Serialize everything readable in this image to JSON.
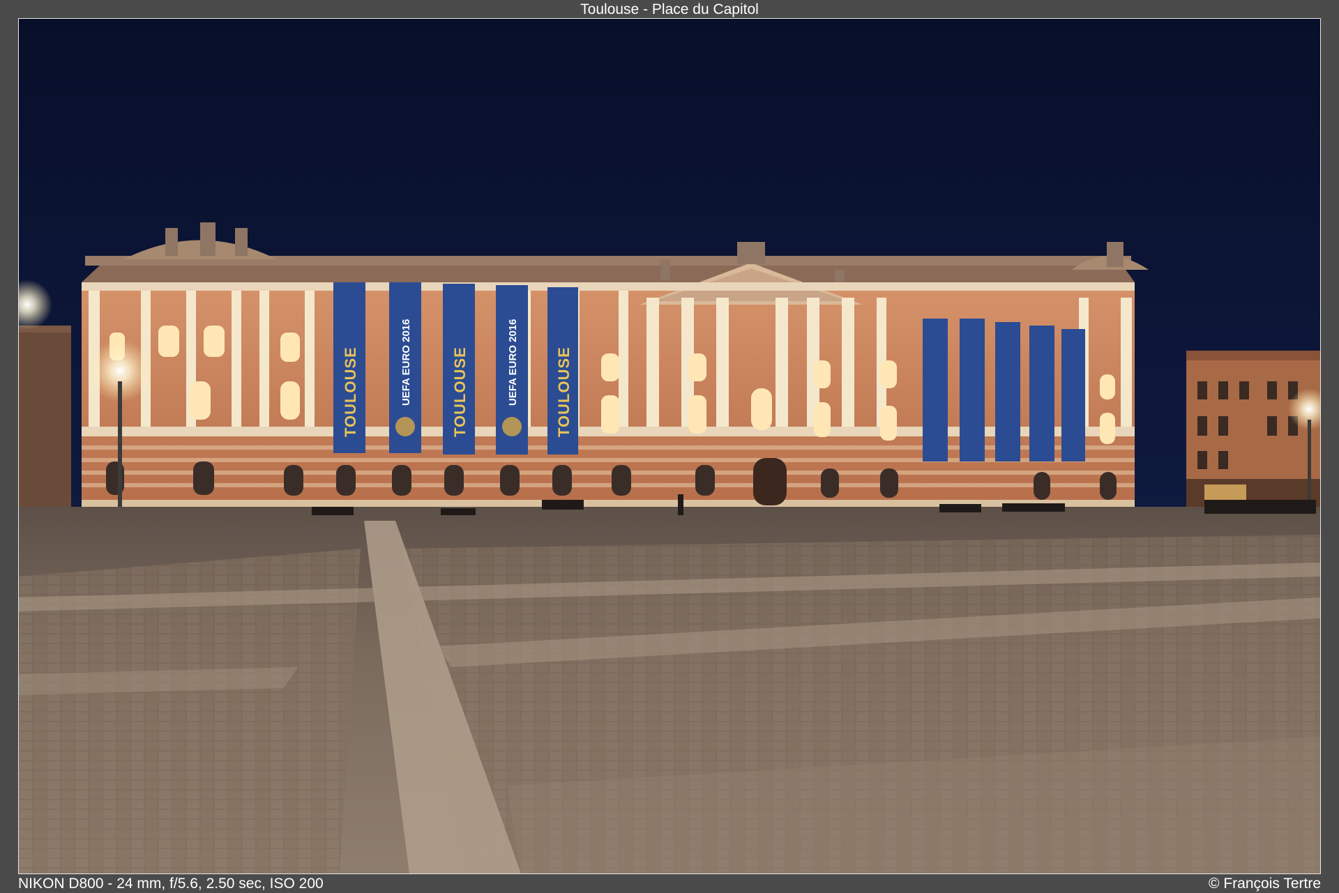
{
  "title": "Toulouse - Place du Capitol",
  "exif": "NIKON D800 - 24 mm, f/5.6, 2.50 sec, ISO 200",
  "credit": "© François Tertre",
  "photo": {
    "subject": "Capitole de Toulouse at night",
    "banners": [
      "TOULOUSE",
      "UEFA EURO 2016",
      "TOULOUSE",
      "UEFA EURO 2016",
      "TOULOUSE"
    ],
    "colors": {
      "sky": "#0c1433",
      "facade": "#c8825a",
      "stone": "#efe2c8",
      "banner": "#2a4a8c",
      "paving": "#8a7766"
    }
  }
}
